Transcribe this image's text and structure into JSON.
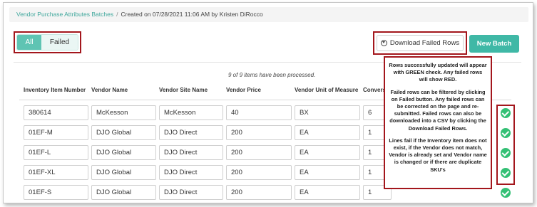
{
  "breadcrumb": {
    "link": "Vendor Purchase Attributes Batches",
    "separator": "/",
    "meta": "Created on 07/28/2021 11:06 AM by Kristen DiRocco"
  },
  "filters": {
    "all": "All",
    "failed": "Failed",
    "selected": "All"
  },
  "buttons": {
    "download_failed": "Download Failed Rows",
    "new_batch": "New Batch"
  },
  "status": {
    "processed": "9 of 9 items have been processed."
  },
  "columns": [
    "Inventory Item Number",
    "Vendor Name",
    "Vendor Site Name",
    "Vendor Price",
    "Vendor Unit of Measure",
    "Convers"
  ],
  "rows": [
    {
      "item": "380614",
      "vendor": "McKesson",
      "site": "McKesson",
      "price": "40",
      "uom": "BX",
      "conv": "6"
    },
    {
      "item": "01EF-M",
      "vendor": "DJO Global",
      "site": "DJO Direct",
      "price": "200",
      "uom": "EA",
      "conv": "1"
    },
    {
      "item": "01EF-L",
      "vendor": "DJO Global",
      "site": "DJO Direct",
      "price": "200",
      "uom": "EA",
      "conv": "1"
    },
    {
      "item": "01EF-XL",
      "vendor": "DJO Global",
      "site": "DJO Direct",
      "price": "200",
      "uom": "EA",
      "conv": "1"
    },
    {
      "item": "01EF-S",
      "vendor": "DJO Global",
      "site": "DJO Direct",
      "price": "200",
      "uom": "EA",
      "conv": "1"
    }
  ],
  "annotation": {
    "p1": "Rows successfully updated will appear with GREEN check.  Any failed rows will show RED.",
    "p2": "Failed rows can be filtered by clicking on Failed button.  Any failed rows can be corrected on the page and re-submitted. Failed rows can also be downloaded into a CSV by clicking the Download Failed Rows.",
    "p3": "Lines fail if the Inventory item does not exist, if the Vendor does not match, Vendor is already set and Vendor name is changed or if there are duplicate SKU's"
  },
  "colors": {
    "accent": "#3fb8a6",
    "highlight": "#a3161c",
    "success": "#34c075"
  }
}
